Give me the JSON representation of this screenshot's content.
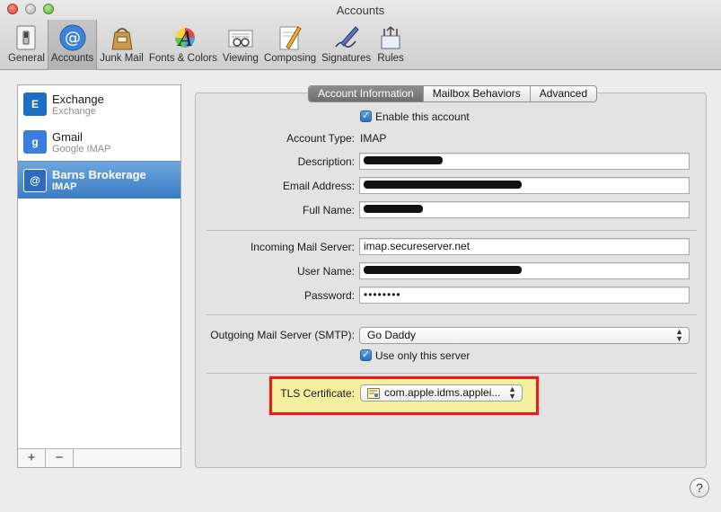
{
  "window": {
    "title": "Accounts"
  },
  "toolbar": {
    "items": [
      {
        "label": "General",
        "icon": "general-switch-icon"
      },
      {
        "label": "Accounts",
        "icon": "at-sign-icon",
        "active": true
      },
      {
        "label": "Junk Mail",
        "icon": "junk-mail-bag-icon"
      },
      {
        "label": "Fonts & Colors",
        "icon": "fonts-colors-icon"
      },
      {
        "label": "Viewing",
        "icon": "viewing-glasses-icon"
      },
      {
        "label": "Composing",
        "icon": "composing-pencil-icon"
      },
      {
        "label": "Signatures",
        "icon": "signatures-pen-icon"
      },
      {
        "label": "Rules",
        "icon": "rules-arrows-icon"
      }
    ]
  },
  "accounts": [
    {
      "name": "Exchange",
      "type": "Exchange",
      "icon": "exchange-icon",
      "color": "#1d6fc1"
    },
    {
      "name": "Gmail",
      "type": "Google IMAP",
      "icon": "google-icon",
      "color": "#3b7de0"
    },
    {
      "name": "Barns Brokerage",
      "type": "IMAP",
      "icon": "at-sign-icon",
      "color": "#2c6cc0",
      "selected": true
    }
  ],
  "list_footer": {
    "add": "+",
    "remove": "−"
  },
  "tabs": [
    {
      "label": "Account Information",
      "active": true
    },
    {
      "label": "Mailbox Behaviors"
    },
    {
      "label": "Advanced"
    }
  ],
  "form": {
    "enable_label": "Enable this account",
    "account_type_label": "Account Type:",
    "account_type_value": "IMAP",
    "description_label": "Description:",
    "email_label": "Email Address:",
    "fullname_label": "Full Name:",
    "incoming_label": "Incoming Mail Server:",
    "incoming_value": "imap.secureserver.net",
    "username_label": "User Name:",
    "password_label": "Password:",
    "password_value": "••••••••",
    "smtp_label": "Outgoing Mail Server (SMTP):",
    "smtp_value": "Go Daddy",
    "use_only_label": "Use only this server",
    "tls_label": "TLS Certificate:",
    "tls_value": "com.apple.idms.applei..."
  },
  "help": "?",
  "colors": {
    "highlight_border": "#e02020",
    "selection_blue": "#3b7cc4"
  }
}
